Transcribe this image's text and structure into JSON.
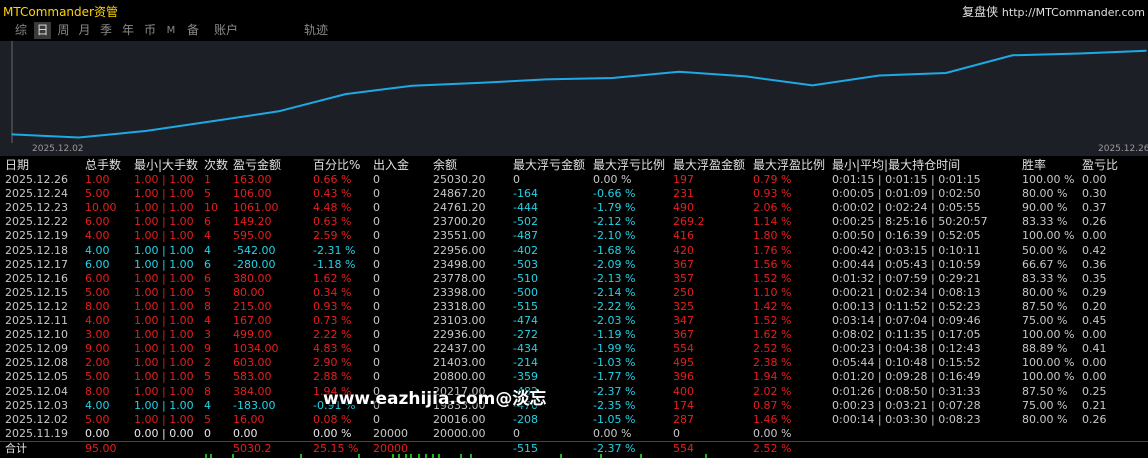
{
  "window": {
    "title": "MTCommander资管",
    "brand": "复盘侠",
    "url": "http://MTCommander.com"
  },
  "tabs": [
    "综",
    "日",
    "周",
    "月",
    "季",
    "年",
    "币",
    "M",
    "备",
    "账户",
    "轨迹"
  ],
  "active_tab": "日",
  "chart_data": {
    "type": "line",
    "x_start_label": "2025.12.02",
    "x_end_label": "2025.12.26",
    "x": [
      "2025.12.02",
      "2025.12.03",
      "2025.12.04",
      "2025.12.05",
      "2025.12.08",
      "2025.12.09",
      "2025.12.10",
      "2025.12.11",
      "2025.12.12",
      "2025.12.15",
      "2025.12.16",
      "2025.12.17",
      "2025.12.18",
      "2025.12.19",
      "2025.12.22",
      "2025.12.23",
      "2025.12.24",
      "2025.12.26"
    ],
    "y": [
      20016.0,
      19833.0,
      20217.0,
      20800.0,
      21403.0,
      22437.0,
      22936.0,
      23103.0,
      23318.0,
      23398.0,
      23778.0,
      23498.0,
      22956.0,
      23551.0,
      23700.2,
      24761.2,
      24867.2,
      25030.2
    ],
    "ylim": [
      19500,
      25500
    ],
    "grid": false,
    "line_color": "#1ea9e6"
  },
  "table": {
    "headers": [
      "日期",
      "总手数",
      "最小|大手数",
      "次数",
      "盈亏金额",
      "百分比%",
      "出入金",
      "余额",
      "最大浮亏金额",
      "最大浮亏比例",
      "最大浮盈金额",
      "最大浮盈比例",
      "最小|平均|最大持仓时间",
      "胜率",
      "盈亏比"
    ],
    "rows": [
      [
        "2025.12.26",
        "1.00",
        "1.00 | 1.00",
        "1",
        "163.00",
        "0.66 %",
        "0",
        "25030.20",
        "0",
        "0.00 %",
        "197",
        "0.79 %",
        "0:01:15 | 0:01:15 | 0:01:15",
        "100.00 %",
        "0.00"
      ],
      [
        "2025.12.24",
        "5.00",
        "1.00 | 1.00",
        "5",
        "106.00",
        "0.43 %",
        "0",
        "24867.20",
        "-164",
        "-0.66 %",
        "231",
        "0.93 %",
        "0:00:05 | 0:01:09 | 0:02:50",
        "80.00 %",
        "0.30"
      ],
      [
        "2025.12.23",
        "10.00",
        "1.00 | 1.00",
        "10",
        "1061.00",
        "4.48 %",
        "0",
        "24761.20",
        "-444",
        "-1.79 %",
        "490",
        "2.06 %",
        "0:00:02 | 0:02:24 | 0:05:55",
        "90.00 %",
        "0.37"
      ],
      [
        "2025.12.22",
        "6.00",
        "1.00 | 1.00",
        "6",
        "149.20",
        "0.63 %",
        "0",
        "23700.20",
        "-502",
        "-2.12 %",
        "269.2",
        "1.14 %",
        "0:00:25 | 8:25:16 | 50:20:57",
        "83.33 %",
        "0.26"
      ],
      [
        "2025.12.19",
        "4.00",
        "1.00 | 1.00",
        "4",
        "595.00",
        "2.59 %",
        "0",
        "23551.00",
        "-487",
        "-2.10 %",
        "416",
        "1.80 %",
        "0:00:50 | 0:16:39 | 0:52:05",
        "100.00 %",
        "0.00"
      ],
      [
        "2025.12.18",
        "4.00",
        "1.00 | 1.00",
        "4",
        "-542.00",
        "-2.31 %",
        "0",
        "22956.00",
        "-402",
        "-1.68 %",
        "420",
        "1.76 %",
        "0:00:42 | 0:03:15 | 0:10:11",
        "50.00 %",
        "0.42"
      ],
      [
        "2025.12.17",
        "6.00",
        "1.00 | 1.00",
        "6",
        "-280.00",
        "-1.18 %",
        "0",
        "23498.00",
        "-503",
        "-2.09 %",
        "367",
        "1.56 %",
        "0:00:44 | 0:05:43 | 0:10:59",
        "66.67 %",
        "0.36"
      ],
      [
        "2025.12.16",
        "6.00",
        "1.00 | 1.00",
        "6",
        "380.00",
        "1.62 %",
        "0",
        "23778.00",
        "-510",
        "-2.13 %",
        "357",
        "1.52 %",
        "0:01:32 | 0:07:59 | 0:29:21",
        "83.33 %",
        "0.35"
      ],
      [
        "2025.12.15",
        "5.00",
        "1.00 | 1.00",
        "5",
        "80.00",
        "0.34 %",
        "0",
        "23398.00",
        "-500",
        "-2.14 %",
        "250",
        "1.10 %",
        "0:00:21 | 0:02:34 | 0:08:13",
        "80.00 %",
        "0.29"
      ],
      [
        "2025.12.12",
        "8.00",
        "1.00 | 1.00",
        "8",
        "215.00",
        "0.93 %",
        "0",
        "23318.00",
        "-515",
        "-2.22 %",
        "325",
        "1.42 %",
        "0:00:13 | 0:11:52 | 0:52:23",
        "87.50 %",
        "0.20"
      ],
      [
        "2025.12.11",
        "4.00",
        "1.00 | 1.00",
        "4",
        "167.00",
        "0.73 %",
        "0",
        "23103.00",
        "-474",
        "-2.03 %",
        "347",
        "1.52 %",
        "0:03:14 | 0:07:04 | 0:09:46",
        "75.00 %",
        "0.45"
      ],
      [
        "2025.12.10",
        "3.00",
        "1.00 | 1.00",
        "3",
        "499.00",
        "2.22 %",
        "0",
        "22936.00",
        "-272",
        "-1.19 %",
        "367",
        "1.62 %",
        "0:08:02 | 0:11:35 | 0:17:05",
        "100.00 %",
        "0.00"
      ],
      [
        "2025.12.09",
        "9.00",
        "1.00 | 1.00",
        "9",
        "1034.00",
        "4.83 %",
        "0",
        "22437.00",
        "-434",
        "-1.99 %",
        "554",
        "2.52 %",
        "0:00:23 | 0:04:38 | 0:12:43",
        "88.89 %",
        "0.41"
      ],
      [
        "2025.12.08",
        "2.00",
        "1.00 | 1.00",
        "2",
        "603.00",
        "2.90 %",
        "0",
        "21403.00",
        "-214",
        "-1.03 %",
        "495",
        "2.38 %",
        "0:05:44 | 0:10:48 | 0:15:52",
        "100.00 %",
        "0.00"
      ],
      [
        "2025.12.05",
        "5.00",
        "1.00 | 1.00",
        "5",
        "583.00",
        "2.88 %",
        "0",
        "20800.00",
        "-359",
        "-1.77 %",
        "396",
        "1.94 %",
        "0:01:20 | 0:09:28 | 0:16:49",
        "100.00 %",
        "0.00"
      ],
      [
        "2025.12.04",
        "8.00",
        "1.00 | 1.00",
        "8",
        "384.00",
        "1.94 %",
        "0",
        "20217.00",
        "-482",
        "-2.37 %",
        "400",
        "2.02 %",
        "0:01:26 | 0:08:50 | 0:31:33",
        "87.50 %",
        "0.25"
      ],
      [
        "2025.12.03",
        "4.00",
        "1.00 | 1.00",
        "4",
        "-183.00",
        "-0.91 %",
        "0",
        "19833.00",
        "-470",
        "-2.35 %",
        "174",
        "0.87 %",
        "0:00:23 | 0:03:21 | 0:07:28",
        "75.00 %",
        "0.21"
      ],
      [
        "2025.12.02",
        "5.00",
        "1.00 | 1.00",
        "5",
        "16.00",
        "0.08 %",
        "0",
        "20016.00",
        "-208",
        "-1.05 %",
        "287",
        "1.46 %",
        "0:00:14 | 0:03:30 | 0:08:23",
        "80.00 %",
        "0.26"
      ],
      [
        "2025.11.19",
        "0.00",
        "0.00 | 0.00",
        "0",
        "0.00",
        "0.00 %",
        "20000",
        "20000.00",
        "0",
        "0.00 %",
        "0",
        "0.00 %",
        "",
        "",
        ""
      ]
    ],
    "total": [
      "合计",
      "95.00",
      "",
      "",
      "5030.2",
      "25.15 %",
      "20000",
      "",
      "-515",
      "-2.37 %",
      "554",
      "2.52 %",
      "",
      "",
      ""
    ]
  },
  "watermark": "www.eazhijia.com@淡忘",
  "colors": {
    "positive": "#e61e1e",
    "negative": "#22d3e6",
    "neutral": "#c8c8c8",
    "title": "#ffd400",
    "chart_bg": "#1c1f26"
  }
}
